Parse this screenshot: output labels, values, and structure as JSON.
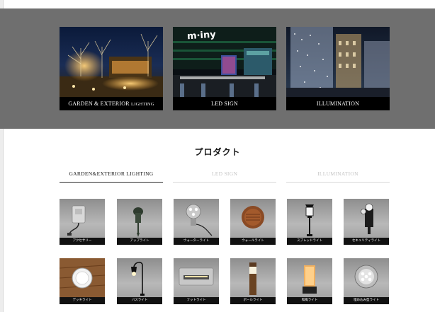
{
  "hero": {
    "cards": [
      {
        "title": "GARDEN & EXTERIOR",
        "subtitle": "LIGHTING"
      },
      {
        "title": "LED SIGN",
        "subtitle": ""
      },
      {
        "title": "ILLUMINATION",
        "subtitle": ""
      }
    ],
    "sign_text": "m·iny"
  },
  "products": {
    "title": "プロダクト",
    "tabs": [
      {
        "label": "GARDEN&EXTERIOR LIGHTING",
        "active": true
      },
      {
        "label": "LED SIGN",
        "active": false
      },
      {
        "label": "ILLUMINATION",
        "active": false
      }
    ],
    "items": [
      {
        "label": "アクセサリー",
        "icon": "outdoor-socket-icon"
      },
      {
        "label": "アップライト",
        "icon": "spike-spotlight-icon"
      },
      {
        "label": "ウォーターライト",
        "icon": "underwater-light-icon"
      },
      {
        "label": "ウォールライト",
        "icon": "wall-light-icon"
      },
      {
        "label": "スプレッドライト",
        "icon": "lantern-post-icon"
      },
      {
        "label": "セキュリティライト",
        "icon": "security-light-icon"
      },
      {
        "label": "デッキライト",
        "icon": "deck-light-icon"
      },
      {
        "label": "バスライト",
        "icon": "path-light-icon"
      },
      {
        "label": "フットライト",
        "icon": "foot-light-icon"
      },
      {
        "label": "ポールライト",
        "icon": "bollard-light-icon"
      },
      {
        "label": "和風ライト",
        "icon": "japanese-lantern-icon"
      },
      {
        "label": "埋め込み型ライト",
        "icon": "inground-light-icon"
      }
    ]
  },
  "colors": {
    "hero_band": "#6f6f6f",
    "caption_bg": "#000000",
    "tab_active": "#1a1a1a",
    "tab_inactive": "#c5c5c5"
  }
}
